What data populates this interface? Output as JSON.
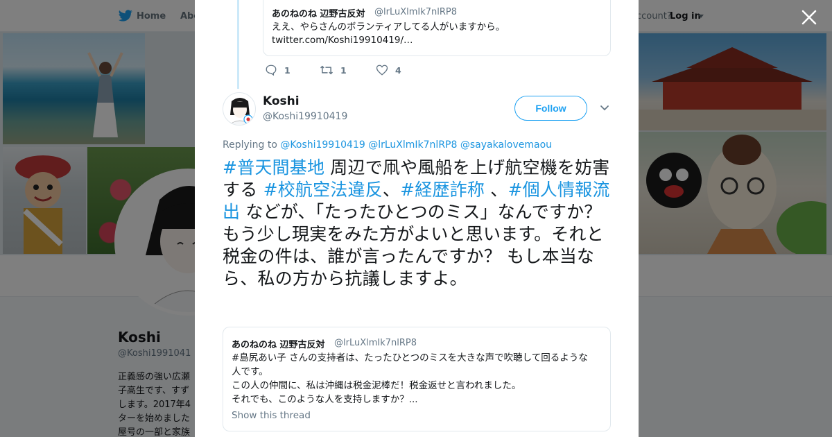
{
  "nav": {
    "home": "Home",
    "about": "Abo",
    "account_prompt": "ccount?",
    "login": "Log in",
    "bird_icon": "twitter-bird-icon",
    "accent": "#1da1f2"
  },
  "profile_bg": {
    "name": "Koshi",
    "handle": "@Koshi1991041",
    "bio_lines": [
      "正義感の強い広瀬",
      "子高生です、すず",
      "します。2017年4",
      "ターを始めました",
      "屋号の一部と家族"
    ]
  },
  "modal": {
    "close_icon": "close-icon",
    "parent_quote": {
      "name": "あのねのね 辺野古反対",
      "handle": "@lrLuXlmIk7nlRP8",
      "line1": "ええ、やらさんのボランティアしてる人がいますから。",
      "line2": "twitter.com/Koshi19910419/…"
    },
    "actions": {
      "reply_count": "1",
      "retweet_count": "1",
      "like_count": "4"
    },
    "tweet": {
      "name": "Koshi",
      "handle": "@Koshi19910419",
      "follow_label": "Follow",
      "replying_label": "Replying to",
      "replying_to": [
        "@Koshi19910419",
        "@lrLuXlmIk7nlRP8",
        "@sayakalovemaou"
      ],
      "segments": [
        {
          "text": "#普天間基地",
          "tag": true
        },
        {
          "text": " 周辺で凧や風船を上げ航空機を妨害する ",
          "tag": false
        },
        {
          "text": "#校航空法違反",
          "tag": true
        },
        {
          "text": "、",
          "tag": false
        },
        {
          "text": "#経歴詐称",
          "tag": true
        },
        {
          "text": " 、",
          "tag": false
        },
        {
          "text": "#個人情報流出",
          "tag": true
        },
        {
          "text": " などが、「たったひとつのミス」なんですか？　もう少し現実をみた方がよいと思います。それと税金の件は、誰が言ったんですか？ もし本当なら、私の方から抗議しますよ。",
          "tag": false
        }
      ]
    },
    "quoted": {
      "name": "あのねのね 辺野古反対",
      "handle": "@lrLuXlmIk7nlRP8",
      "line1": "#島尻あい子 さんの支持者は、たったひとつのミスを大きな声で吹聴して回るような",
      "line2": "人です。",
      "line3": "この人の仲間に、私は沖縄は税金泥棒だ！税金返せと言われました。",
      "line4": "それでも、このような人を支持しますか？...",
      "show_thread": "Show this thread"
    }
  }
}
